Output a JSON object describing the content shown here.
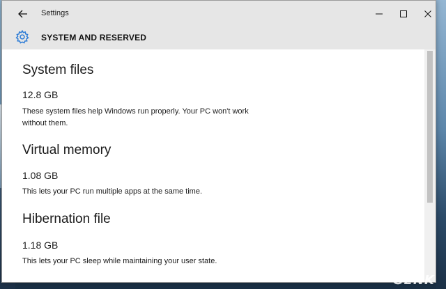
{
  "window": {
    "app_title": "Settings",
    "page_title": "SYSTEM AND RESERVED"
  },
  "icons": {
    "back": "back-arrow-icon",
    "gear": "gear-icon",
    "minimize": "minimize-icon",
    "maximize": "maximize-icon",
    "close": "close-icon",
    "accent_color": "#2b7bd6"
  },
  "sections": [
    {
      "heading": "System files",
      "size": "12.8 GB",
      "description": "These system files help Windows run properly. Your PC won't work without them."
    },
    {
      "heading": "Virtual memory",
      "size": "1.08 GB",
      "description": "This lets your PC run multiple apps at the same time."
    },
    {
      "heading": "Hibernation file",
      "size": "1.18 GB",
      "description": "This lets your PC sleep while maintaining your user state."
    }
  ],
  "watermark": "GENK"
}
